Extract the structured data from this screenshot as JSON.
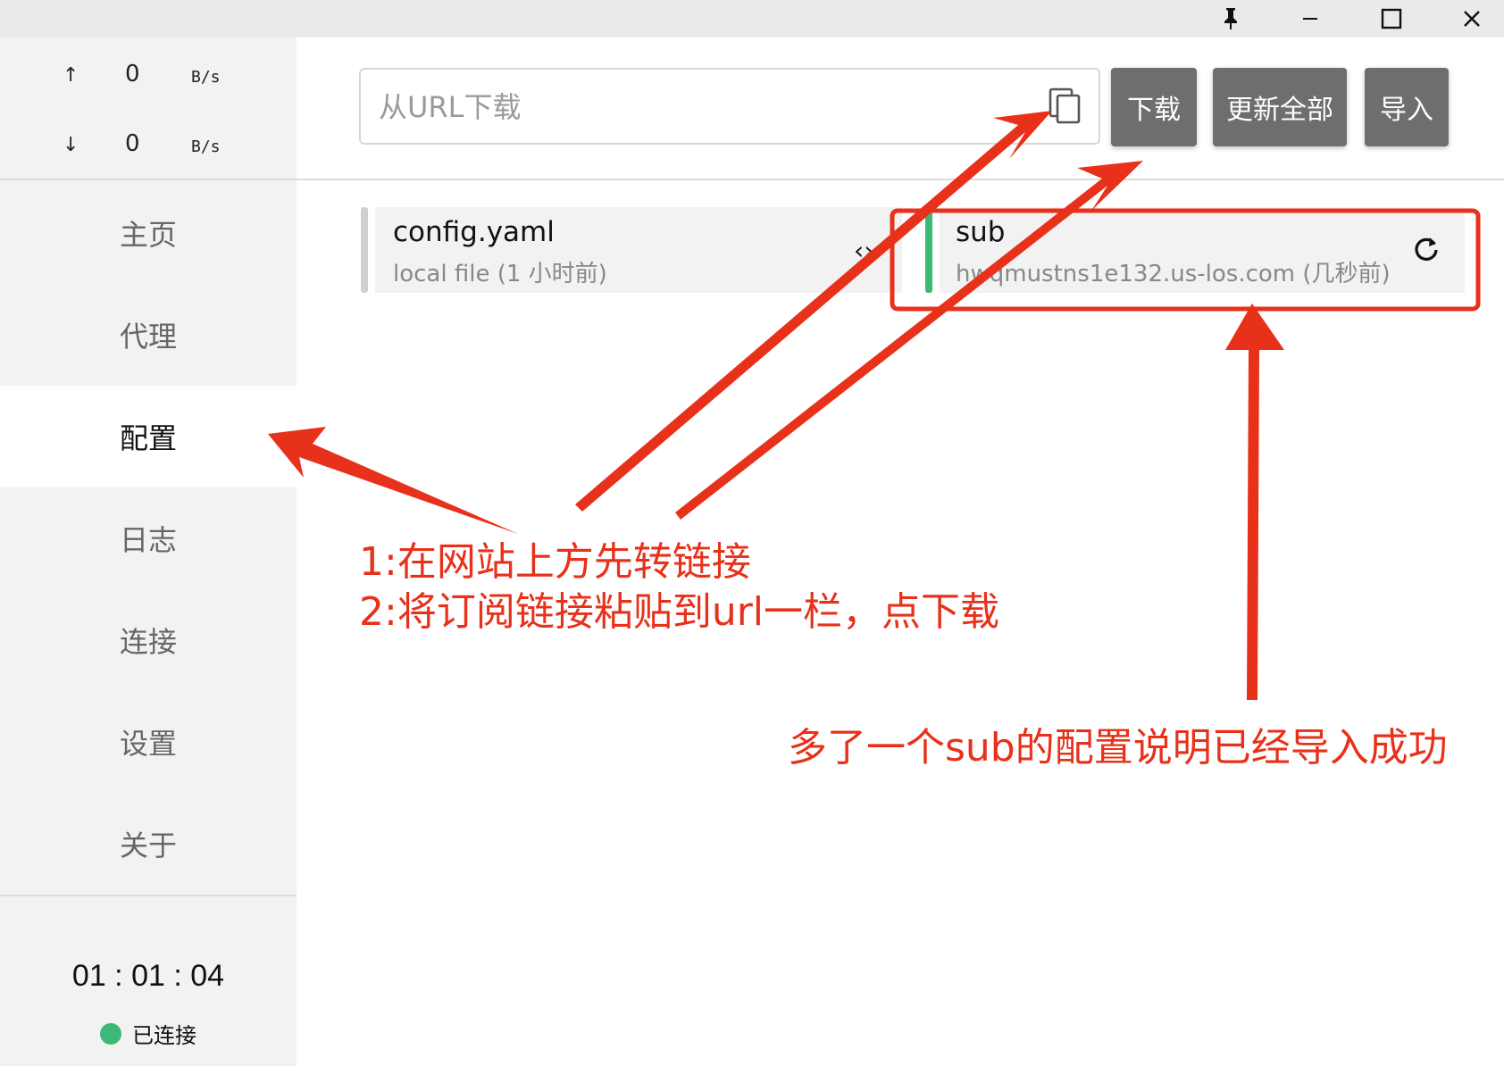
{
  "window": {
    "pin_icon": "pin-icon",
    "minimize": "minimize-icon",
    "maximize": "maximize-icon",
    "close": "close-icon"
  },
  "traffic": {
    "up": {
      "arrow": "↑",
      "value": "0",
      "unit": "B/s"
    },
    "down": {
      "arrow": "↓",
      "value": "0",
      "unit": "B/s"
    }
  },
  "nav": [
    {
      "label": "主页"
    },
    {
      "label": "代理"
    },
    {
      "label": "配置",
      "active": true
    },
    {
      "label": "日志"
    },
    {
      "label": "连接"
    },
    {
      "label": "设置"
    },
    {
      "label": "关于"
    }
  ],
  "footer": {
    "time": "01 : 01 : 04",
    "status": "已连接",
    "status_color": "#3cb878"
  },
  "toolbar": {
    "url_placeholder": "从URL下载",
    "url_value": "",
    "download_label": "下载",
    "update_all_label": "更新全部",
    "import_label": "导入"
  },
  "profiles": [
    {
      "name": "config.yaml",
      "meta": "local file (1 小时前)",
      "bar_color": "#d0d0d0",
      "icon": "code-icon"
    },
    {
      "name": "sub",
      "meta": "hwqmustns1e132.us-los.com (几秒前)",
      "bar_color": "#3cb878",
      "icon": "refresh-icon"
    }
  ],
  "annotations": {
    "step1": "1:在网站上方先转链接",
    "step2": "2:将订阅链接粘贴到url一栏，点下载",
    "result": "多了一个sub的配置说明已经导入成功",
    "color": "#e8311a"
  }
}
